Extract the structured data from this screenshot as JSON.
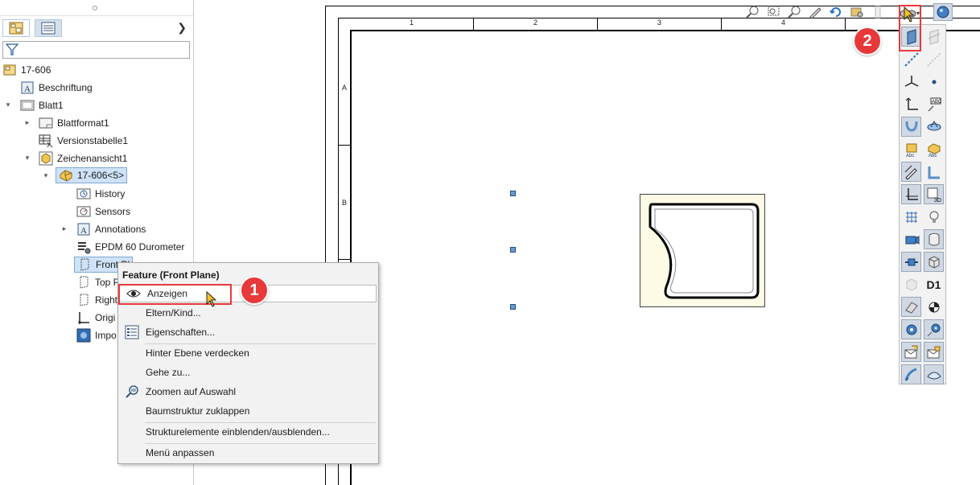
{
  "feature_tree": {
    "part_name": "17-606",
    "items": [
      {
        "label": "Beschriftung",
        "icon": "annotation-icon"
      },
      {
        "label": "Blatt1",
        "icon": "sheet-icon"
      },
      {
        "label": "Blattformat1",
        "icon": "sheet-format-icon"
      },
      {
        "label": "Versionstabelle1",
        "icon": "revision-table-icon"
      },
      {
        "label": "Zeichenansicht1",
        "icon": "drawing-view-icon"
      },
      {
        "label": "17-606<5>",
        "icon": "part-icon"
      },
      {
        "label": "History",
        "icon": "history-folder-icon"
      },
      {
        "label": "Sensors",
        "icon": "sensors-icon"
      },
      {
        "label": "Annotations",
        "icon": "annotations-icon"
      },
      {
        "label": "EPDM 60 Durometer",
        "icon": "material-icon"
      },
      {
        "label": "Front Pl",
        "icon": "plane-icon"
      },
      {
        "label": "Top P",
        "icon": "plane-icon"
      },
      {
        "label": "Right",
        "icon": "plane-icon"
      },
      {
        "label": "Origi",
        "icon": "origin-icon"
      },
      {
        "label": "Impo",
        "icon": "imported-body-icon"
      }
    ]
  },
  "context_menu": {
    "title": "Feature (Front Plane)",
    "items": [
      {
        "label": "Anzeigen",
        "icon": "eye-icon"
      },
      {
        "label": "Eltern/Kind...",
        "icon": ""
      },
      {
        "label": "Eigenschaften...",
        "icon": "properties-icon"
      },
      {
        "label": "Hinter Ebene verdecken",
        "icon": ""
      },
      {
        "label": "Gehe zu...",
        "icon": ""
      },
      {
        "label": "Zoomen auf Auswahl",
        "icon": "zoom-selection-icon"
      },
      {
        "label": "Baumstruktur zuklappen",
        "icon": ""
      },
      {
        "label": "Strukturelemente einblenden/ausblenden...",
        "icon": ""
      },
      {
        "label": "Menü anpassen",
        "icon": ""
      }
    ]
  },
  "drawing": {
    "zone_numbers": [
      "1",
      "2",
      "3",
      "4"
    ],
    "zone_letters": [
      "A",
      "B"
    ]
  },
  "right_toolbar": {
    "dimension_label": "D1"
  },
  "callouts": {
    "one": "1",
    "two": "2"
  },
  "colors": {
    "accent_red": "#e8393a",
    "selection_blue": "#cfe2f7",
    "menu_bg": "#f2f2f2"
  }
}
